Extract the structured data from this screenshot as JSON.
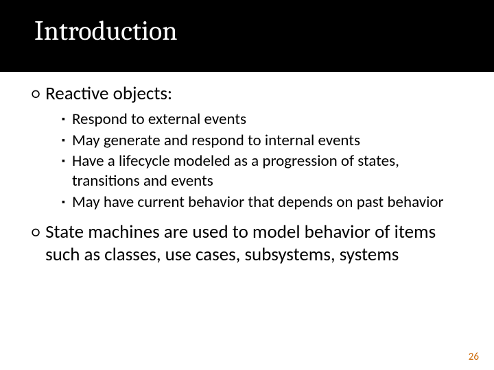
{
  "slide": {
    "title": "Introduction",
    "items": [
      {
        "level": 1,
        "text": "Reactive objects:"
      },
      {
        "level": 2,
        "text": "Respond to external events"
      },
      {
        "level": 2,
        "text": "May generate and respond to internal events"
      },
      {
        "level": 2,
        "text": "Have a lifecycle modeled as a progression of states, transitions and events"
      },
      {
        "level": 2,
        "text": "May have current behavior that depends on past behavior"
      },
      {
        "level": 1,
        "text": "State machines are used to model behavior of items such as classes, use cases, subsystems, systems"
      }
    ],
    "page_number": "26",
    "bullets": {
      "level1": "○",
      "level2": "▪"
    }
  }
}
